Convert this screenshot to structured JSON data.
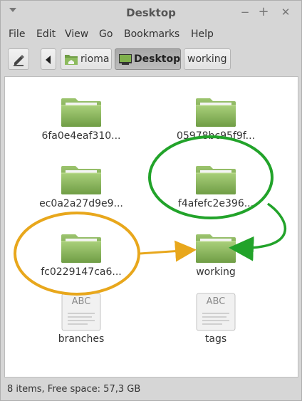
{
  "window": {
    "title": "Desktop"
  },
  "menu": [
    "File",
    "Edit",
    "View",
    "Go",
    "Bookmarks",
    "Help"
  ],
  "toolbar": {
    "path": [
      "rioma",
      "Desktop",
      "working"
    ],
    "active": "Desktop"
  },
  "files": [
    {
      "name": "6fa0e4eaf310...",
      "kind": "folder"
    },
    {
      "name": "05978bc95f9f...",
      "kind": "folder"
    },
    {
      "name": "ec0a2a27d9e9...",
      "kind": "folder"
    },
    {
      "name": "f4afefc2e396...",
      "kind": "folder"
    },
    {
      "name": "fc0229147ca6...",
      "kind": "folder"
    },
    {
      "name": "working",
      "kind": "folder"
    },
    {
      "name": "branches",
      "kind": "text",
      "badge": "ABC"
    },
    {
      "name": "tags",
      "kind": "text",
      "badge": "ABC"
    }
  ],
  "status": "8 items, Free space: 57,3 GB",
  "colors": {
    "folder": "#8dbb5e",
    "annotation_green": "#22a32a",
    "annotation_orange": "#e8a71c"
  },
  "icons": {
    "edit": "pencil-icon",
    "back": "back-arrow-icon",
    "home": "home-folder-icon",
    "desktop": "desktop-icon"
  }
}
